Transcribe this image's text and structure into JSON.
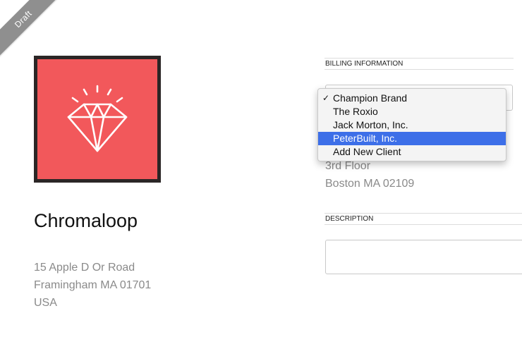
{
  "ribbon": {
    "label": "Draft"
  },
  "company": {
    "name": "Chromaloop",
    "address": [
      "15 Apple D Or Road",
      "Framingham MA 01701",
      "USA"
    ]
  },
  "billing": {
    "header": "BILLING INFORMATION",
    "address_lines": [
      "3rd Floor",
      "Boston MA 02109"
    ],
    "client_select": {
      "options": [
        "Champion Brand",
        "The Roxio",
        "Jack Morton, Inc.",
        "PeterBuilt, Inc.",
        "Add New Client"
      ],
      "checked": "Champion Brand",
      "highlighted": "PeterBuilt, Inc."
    }
  },
  "description": {
    "header": "DESCRIPTION",
    "value": ""
  },
  "colors": {
    "logo_bg": "#f2585b",
    "logo_frame": "#2b2626",
    "highlight": "#3d6fe8",
    "ribbon": "#8f8f8f"
  },
  "icons": {
    "logo": "diamond-icon",
    "check": "checkmark-icon"
  }
}
